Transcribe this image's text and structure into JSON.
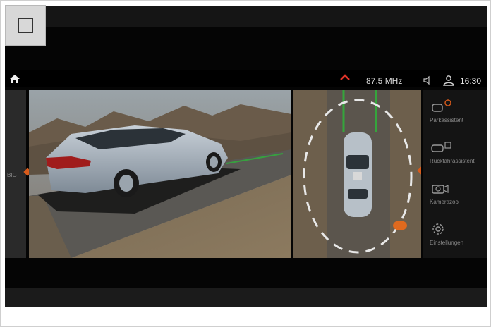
{
  "window": {
    "fullscreen_icon": "square-icon"
  },
  "statusbar": {
    "home_icon": "home-icon",
    "chevron_icon": "chevron-up-icon",
    "accent": "#e2342a",
    "radio_frequency": "87.5 MHz",
    "volume_icon": "speaker-icon",
    "user_icon": "user-icon",
    "time": "16:30"
  },
  "left_panel": {
    "label": "BIG",
    "marker_color": "#d95b1b"
  },
  "side_menu": {
    "items": [
      {
        "label": "Parkassistent",
        "icon": "parking-assistant-icon"
      },
      {
        "label": "Rückfahrassistent",
        "icon": "reversing-assistant-icon"
      },
      {
        "label": "Kamerazoo",
        "icon": "camera-icon"
      },
      {
        "label": "Einstellungen",
        "icon": "gear-icon"
      }
    ]
  },
  "camera": {
    "view_3d": "3d-surround-view",
    "view_top": "top-down-view",
    "guide_color": "#2fb33a",
    "warning_color": "#e06a1e"
  }
}
